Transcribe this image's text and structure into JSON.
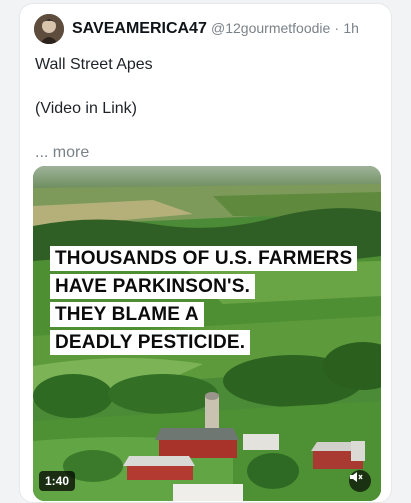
{
  "post": {
    "display_name": "SAVEAMERICA47",
    "handle": "@12gourmetfoodie",
    "separator": "·",
    "time": "1h",
    "text_line1": "Wall Street Apes",
    "text_line2": "(Video in Link)",
    "more_label": "... more"
  },
  "video": {
    "headline_lines": [
      "THOUSANDS OF U.S. FARMERS",
      "HAVE PARKINSON'S.",
      "THEY BLAME A",
      "DEADLY PESTICIDE."
    ],
    "duration": "1:40",
    "mute_icon": "volume-muted-icon"
  },
  "colors": {
    "name": "#0f1419",
    "muted_text": "#7a8289",
    "field_green": "#3d7d2e"
  }
}
